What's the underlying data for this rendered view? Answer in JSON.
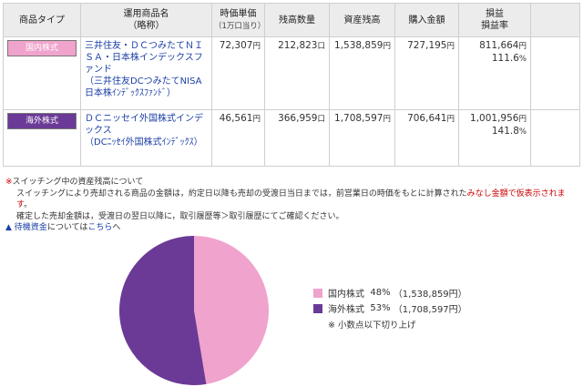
{
  "table": {
    "headers": {
      "type": "商品タイプ",
      "name": "運用商品名",
      "name_sub": "（略称）",
      "unit_price": "時価単価",
      "unit_price_sub": "（1万口当り）",
      "quantity": "残高数量",
      "balance": "資産残高",
      "purchase": "購入金額",
      "pl": "損益",
      "pl_rate": "損益率"
    },
    "rows": [
      {
        "type": "国内株式",
        "type_color": "#f0a3cc",
        "name": "三井住友・ＤＣつみたてＮＩＳＡ・日本株インデックスファンド",
        "name_short": "（三井住友DCつみたてNISA日本株ｲﾝﾃﾞｯｸｽﾌｧﾝﾄﾞ）",
        "unit_price": "72,307",
        "unit_price_unit": "円",
        "quantity": "212,823",
        "quantity_unit": "口",
        "balance": "1,538,859",
        "balance_unit": "円",
        "purchase": "727,195",
        "purchase_unit": "円",
        "pl": "811,664",
        "pl_unit": "円",
        "pl_rate": "111.6",
        "pl_rate_unit": "%"
      },
      {
        "type": "海外株式",
        "type_color": "#6b3a96",
        "name": "ＤＣニッセイ外国株式インデックス",
        "name_short": "（DCﾆｯｾｲ外国株式ｲﾝﾃﾞｯｸｽ）",
        "unit_price": "46,561",
        "unit_price_unit": "円",
        "quantity": "366,959",
        "quantity_unit": "口",
        "balance": "1,708,597",
        "balance_unit": "円",
        "purchase": "706,641",
        "purchase_unit": "円",
        "pl": "1,001,956",
        "pl_unit": "円",
        "pl_rate": "141.8",
        "pl_rate_unit": "%"
      }
    ]
  },
  "notes": {
    "mark": "※",
    "title": "スイッチング中の資産残高について",
    "line1_a": "スイッチングにより売却される商品の金額は，約定日以降も売却の受渡日当日までは，前営業日の時価をもとに計算された",
    "line1_red": "みなし金額で仮表示されます",
    "line1_b": "。",
    "line2": "確定した売却金額は，受渡日の翌日以降に，取引履歴等＞取引履歴にてご確認ください。",
    "cash_triangle": "▲",
    "cash_link": "待機資金",
    "cash_mid": "については",
    "cash_here": "こちら",
    "cash_end": "へ"
  },
  "chart_data": {
    "type": "pie",
    "title": "",
    "series": [
      {
        "name": "国内株式",
        "percent": 48,
        "value": 1538859,
        "value_label": "（1,538,859円）",
        "color": "#f0a3cc"
      },
      {
        "name": "海外株式",
        "percent": 53,
        "value": 1708597,
        "value_label": "（1,708,597円）",
        "color": "#6b3a96"
      }
    ],
    "legend_position": "right",
    "note": "※ 小数点以下切り上げ"
  },
  "legend": {
    "items": [
      {
        "label": "国内株式",
        "percent": "48%",
        "value": "（1,538,859円）",
        "color": "#f0a3cc"
      },
      {
        "label": "海外株式",
        "percent": "53%",
        "value": "（1,708,597円）",
        "color": "#6b3a96"
      }
    ],
    "note": "※ 小数点以下切り上げ"
  }
}
